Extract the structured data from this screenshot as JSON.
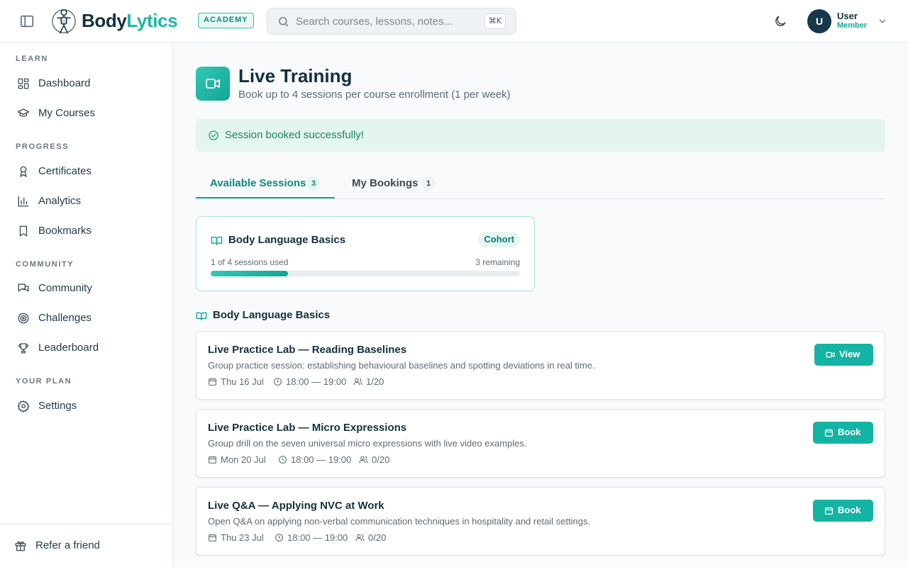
{
  "header": {
    "brand_part1": "Body",
    "brand_part2": "Lytics",
    "academy_badge": "ACADEMY",
    "search_placeholder": "Search courses, lessons, notes...",
    "search_shortcut": "⌘K",
    "user_initial": "U",
    "user_name": "User",
    "user_role": "Member"
  },
  "sidebar": {
    "sections": [
      {
        "title": "LEARN",
        "items": [
          {
            "label": "Dashboard",
            "icon": "dashboard-icon"
          },
          {
            "label": "My Courses",
            "icon": "graduation-cap-icon"
          }
        ]
      },
      {
        "title": "PROGRESS",
        "items": [
          {
            "label": "Certificates",
            "icon": "award-icon"
          },
          {
            "label": "Analytics",
            "icon": "bar-chart-icon"
          },
          {
            "label": "Bookmarks",
            "icon": "bookmark-icon"
          }
        ]
      },
      {
        "title": "COMMUNITY",
        "items": [
          {
            "label": "Community",
            "icon": "chat-icon"
          },
          {
            "label": "Challenges",
            "icon": "target-icon"
          },
          {
            "label": "Leaderboard",
            "icon": "trophy-icon"
          }
        ]
      },
      {
        "title": "YOUR PLAN",
        "items": [
          {
            "label": "Settings",
            "icon": "gear-icon"
          }
        ]
      }
    ],
    "footer_label": "Refer a friend"
  },
  "page": {
    "title": "Live Training",
    "subtitle": "Book up to 4 sessions per course enrollment (1 per week)",
    "alert": "Session booked successfully!"
  },
  "tabs": [
    {
      "label": "Available Sessions",
      "count": "3",
      "active": true
    },
    {
      "label": "My Bookings",
      "count": "1",
      "active": false
    }
  ],
  "enrollment": {
    "title": "Body Language Basics",
    "badge": "Cohort",
    "used_text": "1 of 4 sessions used",
    "remaining_text": "3 remaining",
    "progress": 0.25
  },
  "group_title": "Body Language Basics",
  "sessions": [
    {
      "title": "Live Practice Lab — Reading Baselines",
      "description": "Group practice session: establishing behavioural baselines and spotting deviations in real time.",
      "date": "Thu 16 Jul",
      "time": "18:00 — 19:00",
      "capacity": "1/20",
      "action": "View",
      "action_icon": "video-icon"
    },
    {
      "title": "Live Practice Lab — Micro Expressions",
      "description": "Group drill on the seven universal micro expressions with live video examples.",
      "date": "Mon 20 Jul",
      "time": "18:00 — 19:00",
      "capacity": "0/20",
      "action": "Book",
      "action_icon": "calendar-icon"
    },
    {
      "title": "Live Q&A — Applying NVC at Work",
      "description": "Open Q&A on applying non-verbal communication techniques in hospitality and retail settings.",
      "date": "Thu 23 Jul",
      "time": "18:00 — 19:00",
      "capacity": "0/20",
      "action": "Book",
      "action_icon": "calendar-icon"
    }
  ],
  "colors": {
    "accent": "#14b3a3",
    "brand_dark": "#14303f",
    "success_bg": "#e4f5ee",
    "success_text": "#17875f"
  }
}
